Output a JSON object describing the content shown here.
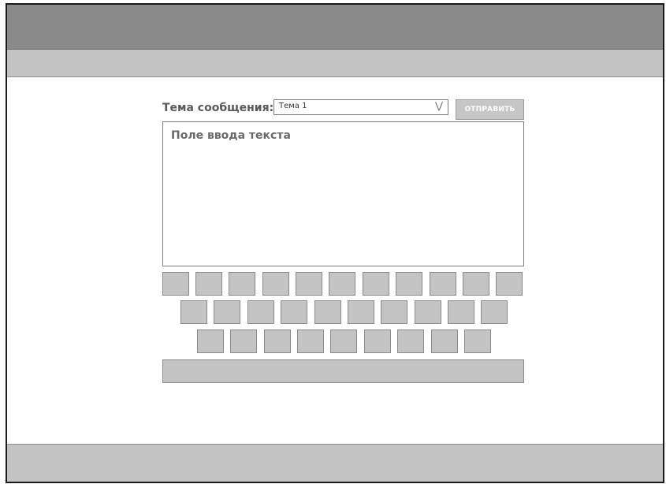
{
  "compose": {
    "subject_label": "Тема сообщения:",
    "subject_value": "Тема 1",
    "subject_chevron": "⋁",
    "send_label": "ОТПРАВИТЬ",
    "text_placeholder": "Поле ввода текста"
  },
  "keyboard": {
    "row1_keys": 11,
    "row2_keys": 10,
    "row3_keys": 9
  },
  "colors": {
    "header": "#8a8a8a",
    "toolbar": "#c4c4c4",
    "key": "#c4c4c4",
    "text": "#595959"
  }
}
